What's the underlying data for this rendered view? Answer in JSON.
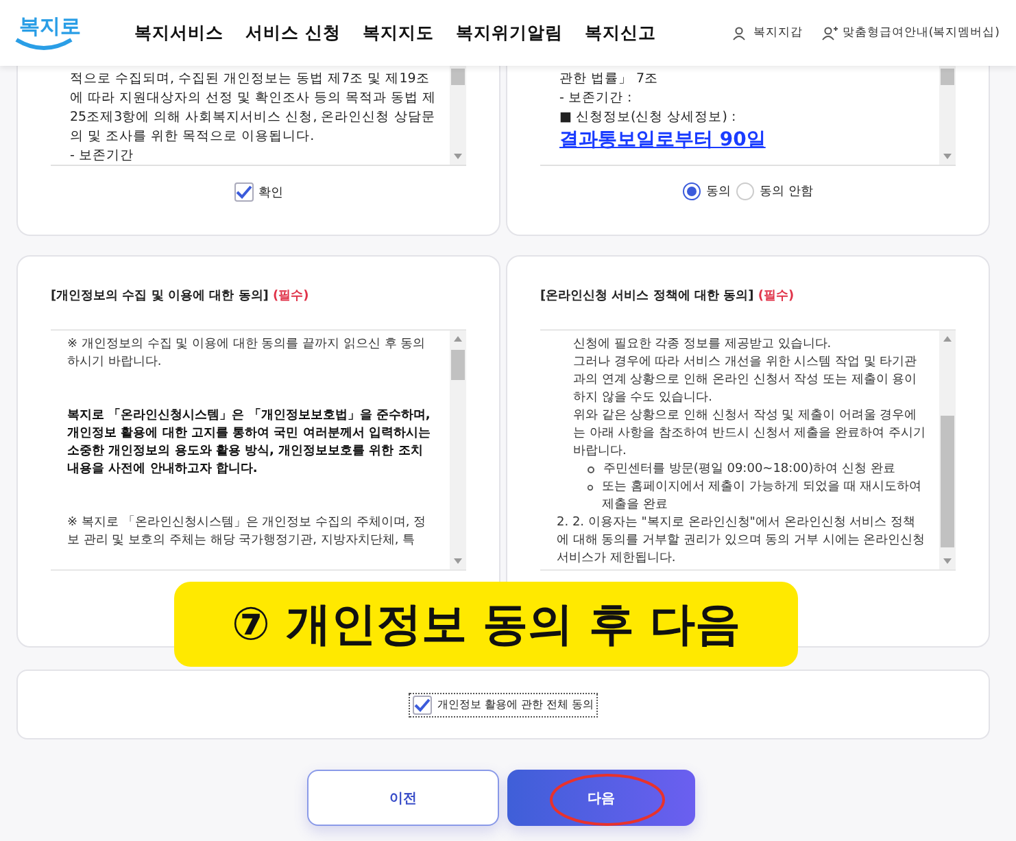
{
  "header": {
    "logo": "복지로",
    "nav": [
      {
        "label": "복지서비스"
      },
      {
        "label": "서비스 신청"
      },
      {
        "label": "복지지도"
      },
      {
        "label": "복지위기알림"
      },
      {
        "label": "복지신고"
      }
    ],
    "utility": [
      {
        "label": "복지지갑",
        "kind": "person"
      },
      {
        "label": "맞춤형급여안내(복지멤버십)",
        "kind": "person-plus"
      }
    ]
  },
  "top_cards": [
    {
      "lines": [
        {
          "kind": "plain",
          "text": "적으로 수집되며, 수집된 개인정보는 동법 제7조 및 제19조에 따라 지원대상자의 선정 및 확인조사 등의 목적과 동법 제25조제3항에 의해 사회복지서비스 신청, 온라인신청 상담문의 및 조사를 위한 목적으로 이용됩니다."
        },
        {
          "kind": "plain",
          "text": "- 보존기간"
        }
      ],
      "control": {
        "kind": "checkbox",
        "label": "확인",
        "checked": true
      }
    },
    {
      "lines": [
        {
          "kind": "plain",
          "text": "관한 법률」 7조"
        },
        {
          "kind": "plain",
          "text": "- 보존기간 :"
        },
        {
          "kind": "link",
          "prefix": "■ 신청정보(신청 상세정보) : ",
          "text": "결과통보일로부터 90일"
        }
      ],
      "control": {
        "kind": "radio",
        "options": [
          {
            "label": "동의",
            "selected": true
          },
          {
            "label": "동의 안함",
            "selected": false
          }
        ]
      }
    }
  ],
  "consent_cards": [
    {
      "title": "[개인정보의 수집 및 이용에 대한 동의]",
      "required": "(필수)",
      "paragraphs": [
        {
          "kind": "note",
          "text": "※ 개인정보의 수집 및 이용에 대한 동의를 끝까지 읽으신 후 동의하시기 바랍니다."
        },
        {
          "kind": "bold",
          "text": "복지로 「온라인신청시스템」은 「개인정보보호법」을 준수하며, 개인정보 활용에 대한 고지를 통하여 국민 여러분께서 입력하시는 소중한 개인정보의 용도와 활용 방식, 개인정보보호를 위한 조치 내용을 사전에 안내하고자 합니다."
        },
        {
          "kind": "note",
          "text": "※ 복지로 「온라인신청시스템」은 개인정보 수집의 주체이며, 정보 관리 및 보호의 주체는 해당 국가행정기관, 지방자치단체, 특"
        }
      ]
    },
    {
      "title": "[온라인신청 서비스 정책에 대한 동의]",
      "required": "(필수)",
      "paragraphs": [
        {
          "kind": "plain",
          "text": "신청에 필요한 각종 정보를 제공받고 있습니다."
        },
        {
          "kind": "plain",
          "text": "그러나 경우에 따라 서비스 개선을 위한 시스템 작업 및 타기관과의 연계 상황으로 인해 온라인 신청서 작성 또는 제출이 용이하지 않을 수도 있습니다."
        },
        {
          "kind": "plain",
          "text": "위와 같은 상황으로 인해 신청서 작성 및 제출이 어려울 경우에는 아래 사항을 참조하여 반드시 신청서 제출을 완료하여 주시기 바랍니다."
        },
        {
          "kind": "bullet",
          "text": "주민센터를 방문(평일 09:00~18:00)하여 신청 완료"
        },
        {
          "kind": "bullet",
          "text": "또는 홈페이지에서 제출이 가능하게 되었을 때 재시도하여 제출을 완료"
        },
        {
          "kind": "numbered",
          "text": "2. 2. 이용자는 \"복지로 온라인신청\"에서 온라인신청 서비스 정책에 대해 동의를 거부할 권리가 있으며 동의 거부 시에는 온라인신청 서비스가 제한됩니다."
        }
      ]
    }
  ],
  "agree_all": {
    "label": "개인정보 활용에 관한 전체 동의",
    "checked": true
  },
  "buttons": [
    {
      "label": "이전",
      "kind": "secondary",
      "circled": false
    },
    {
      "label": "다음",
      "kind": "primary",
      "circled": true
    }
  ],
  "annotation": {
    "text": "⑦ 개인정보 동의 후 다음"
  }
}
